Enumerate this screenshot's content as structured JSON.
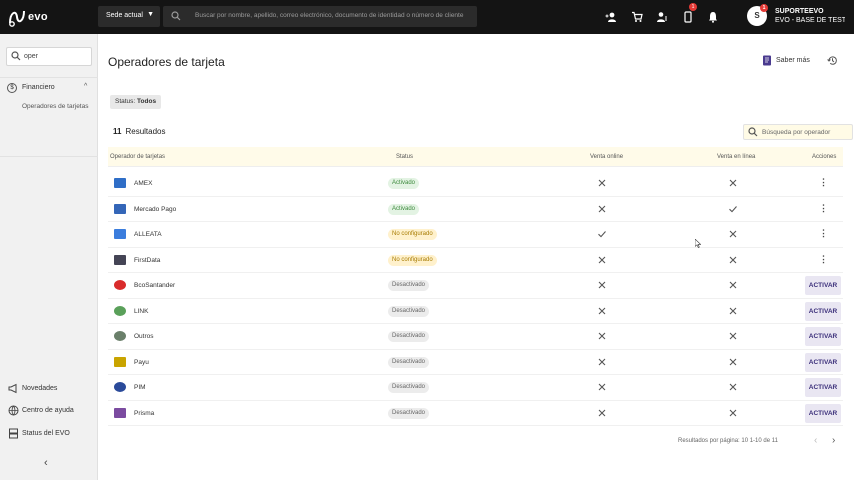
{
  "app": {
    "brand": "evo"
  },
  "topbar": {
    "sede_label": "Sede actual",
    "search_placeholder": "Buscar por nombre, apellido, correo electrónico, documento de identidad o número de cliente",
    "notif_badge": "1",
    "user_initial": "S",
    "user_badge": "1",
    "user_name": "SUPORTEEVO",
    "user_branch": "EVO - BASE DE TESTE..."
  },
  "sidebar": {
    "search_value": "oper",
    "group_label": "Financiero",
    "group_items": [
      "Operadores de tarjetas"
    ],
    "bottom_links": [
      "Novedades",
      "Centro de ayuda",
      "Status del EVO"
    ]
  },
  "main": {
    "title": "Operadores de tarjeta",
    "saber_mas": "Saber más",
    "filter_label": "Status:",
    "filter_value": "Todos",
    "results_count": "11",
    "results_label": "Resultados",
    "table_search_placeholder": "Búsqueda por operador",
    "columns": [
      "Operador de tarjetas",
      "Status",
      "Venta online",
      "Venta en línea",
      "Acciones"
    ],
    "rows": [
      {
        "name": "AMEX",
        "status": "Activado",
        "status_kind": "activado",
        "col1": "x",
        "col2": "x",
        "action": "menu"
      },
      {
        "name": "Mercado Pago",
        "status": "Activado",
        "status_kind": "activado",
        "col1": "x",
        "col2": "check",
        "action": "menu"
      },
      {
        "name": "ALLEATA",
        "status": "No configurado",
        "status_kind": "noconf",
        "col1": "check",
        "col2": "x",
        "action": "menu"
      },
      {
        "name": "FirstData",
        "status": "No configurado",
        "status_kind": "noconf",
        "col1": "x",
        "col2": "x",
        "action": "menu"
      },
      {
        "name": "BcoSantander",
        "status": "Desactivado",
        "status_kind": "desactivado",
        "col1": "x",
        "col2": "x",
        "action": "ACTIVAR"
      },
      {
        "name": "LINK",
        "status": "Desactivado",
        "status_kind": "desactivado",
        "col1": "x",
        "col2": "x",
        "action": "ACTIVAR"
      },
      {
        "name": "Outros",
        "status": "Desactivado",
        "status_kind": "desactivado",
        "col1": "x",
        "col2": "x",
        "action": "ACTIVAR"
      },
      {
        "name": "Payu",
        "status": "Desactivado",
        "status_kind": "desactivado",
        "col1": "x",
        "col2": "x",
        "action": "ACTIVAR"
      },
      {
        "name": "PIM",
        "status": "Desactivado",
        "status_kind": "desactivado",
        "col1": "x",
        "col2": "x",
        "action": "ACTIVAR"
      },
      {
        "name": "Prisma",
        "status": "Desactivado",
        "status_kind": "desactivado",
        "col1": "x",
        "col2": "x",
        "action": "ACTIVAR"
      }
    ],
    "pager_text": "Resultados por página: 10    1-10 de 11"
  },
  "colors": {
    "topbar": "#141414",
    "accent": "#4a3a8f",
    "active_green": "#3d8a3d"
  }
}
